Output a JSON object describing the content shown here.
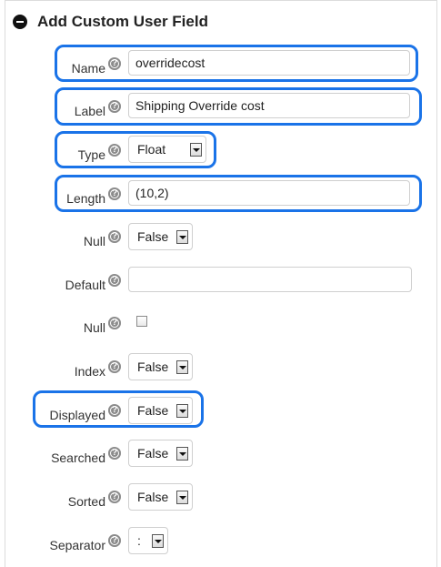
{
  "header": {
    "title": "Add Custom User Field",
    "icon": "collapse-icon"
  },
  "fields": {
    "name": {
      "label": "Name",
      "value": "overridecost"
    },
    "label": {
      "label": "Label",
      "value": "Shipping Override cost"
    },
    "type": {
      "label": "Type",
      "value": "Float"
    },
    "length": {
      "label": "Length",
      "value": "(10,2)"
    },
    "null1": {
      "label": "Null",
      "value": "False"
    },
    "default": {
      "label": "Default",
      "value": ""
    },
    "null2": {
      "label": "Null",
      "checked": false
    },
    "index": {
      "label": "Index",
      "value": "False"
    },
    "displayed": {
      "label": "Displayed",
      "value": "False"
    },
    "searched": {
      "label": "Searched",
      "value": "False"
    },
    "sorted": {
      "label": "Sorted",
      "value": "False"
    },
    "separator": {
      "label": "Separator",
      "value": ":"
    }
  },
  "help_icon_glyph": "?",
  "highlight_color": "#1a73e8"
}
